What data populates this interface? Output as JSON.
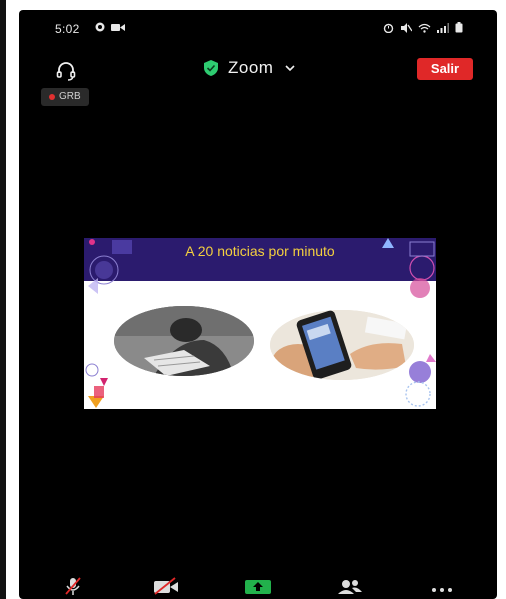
{
  "status_bar": {
    "time": "5:02",
    "left_icons": [
      "whatsapp-icon",
      "video-camera-icon"
    ],
    "right_icons": [
      "alarm-icon",
      "mute-icon",
      "wifi-icon",
      "signal-icon",
      "battery-icon"
    ]
  },
  "meeting": {
    "title": "Zoom",
    "leave_label": "Salir",
    "recording_label": "GRB",
    "colors": {
      "leave": "#e02828",
      "shield": "#2ecc71",
      "share_green": "#22b14c"
    }
  },
  "shared_screen": {
    "title": "A 20 noticias por minuto",
    "colors": {
      "header_bg": "#2b1b6e",
      "title": "#f4d03f"
    }
  },
  "toolbar": {
    "items": [
      {
        "name": "mute",
        "icon": "microphone-muted-icon"
      },
      {
        "name": "video",
        "icon": "video-off-icon"
      },
      {
        "name": "share",
        "icon": "share-screen-icon"
      },
      {
        "name": "participants",
        "icon": "participants-icon"
      },
      {
        "name": "more",
        "icon": "more-icon"
      }
    ]
  }
}
